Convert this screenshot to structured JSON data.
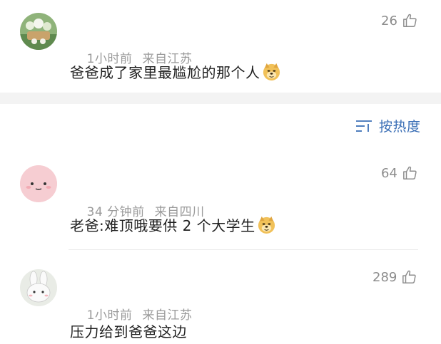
{
  "comments": [
    {
      "likes": "26",
      "time": "1小时前",
      "location": "来自江苏",
      "text": "爸爸成了家里最尴尬的那个人",
      "emoji": "doge-emoji",
      "avatar": "green-photo-avatar"
    },
    {
      "likes": "64",
      "time": "34 分钟前",
      "location": "来自四川",
      "text": "老爸:难顶哦要供 2 个大学生",
      "emoji": "doge-emoji",
      "avatar": "pink-face-avatar"
    },
    {
      "likes": "289",
      "time": "1小时前",
      "location": "来自江苏",
      "text": "压力给到爸爸这边",
      "avatar": "bunny-avatar"
    }
  ],
  "sort": {
    "label": "按热度",
    "icon": "sort-icon"
  },
  "colors": {
    "link": "#3b6fb6",
    "meta": "#9a9a9a",
    "separator": "#f3f3f3"
  }
}
